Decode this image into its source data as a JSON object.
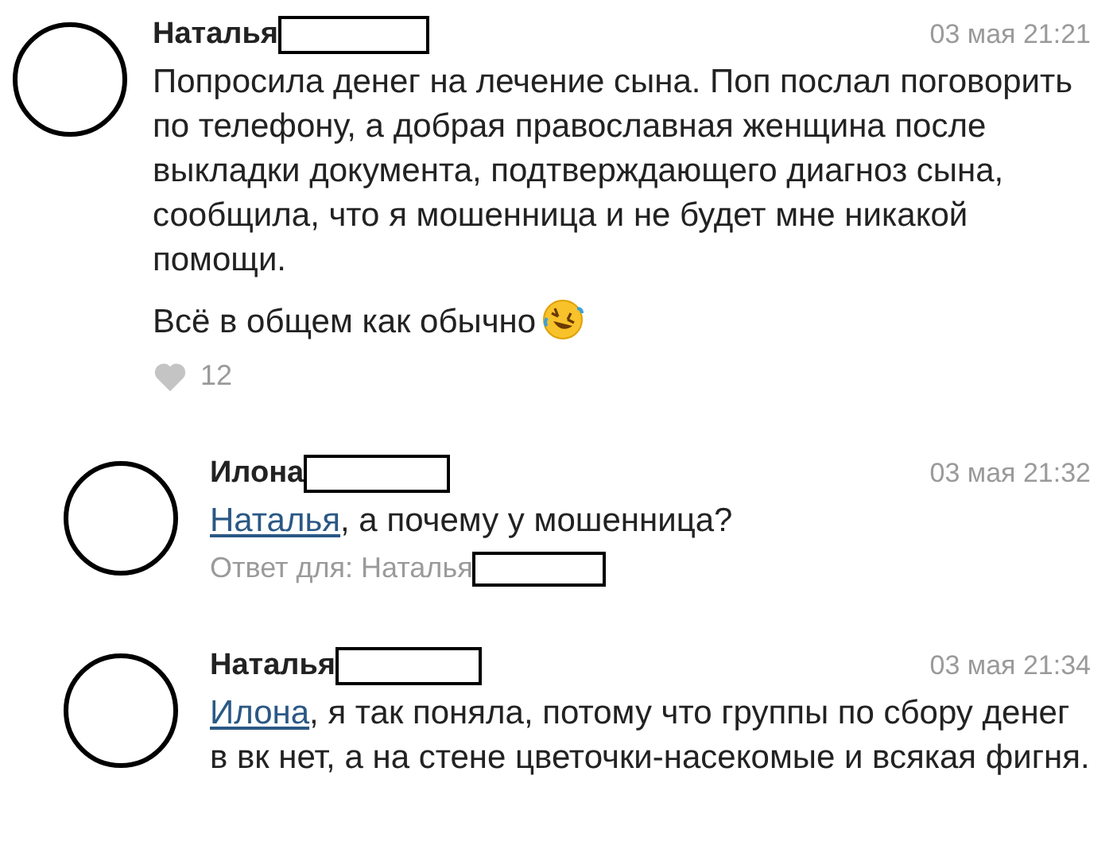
{
  "comments": [
    {
      "author": "Наталья",
      "date": "03 мая 21:21",
      "paragraphs": [
        {
          "text": "Попросила денег на лечение сына. Поп послал поговорить по телефону, а добрая православная женщина после выкладки документа, подтверждающего диагноз сына, сообщила, что я мошенница и не будет мне никакой помощи."
        },
        {
          "text": "Всё в общем как обычно",
          "emoji": true
        }
      ],
      "likes": "12",
      "kind": "comment"
    },
    {
      "author": "Илона",
      "date": "03 мая 21:32",
      "paragraphs": [
        {
          "mention": "Наталья",
          "text": ", а почему у мошенница?"
        }
      ],
      "reply_to": "Ответ для: Наталья",
      "kind": "reply"
    },
    {
      "author": "Наталья",
      "date": "03 мая 21:34",
      "paragraphs": [
        {
          "mention": "Илона",
          "text": ", я так поняла, потому что группы по сбору денег в вк нет, а на стене цветочки-насекомые и всякая фигня."
        }
      ],
      "kind": "reply"
    }
  ]
}
